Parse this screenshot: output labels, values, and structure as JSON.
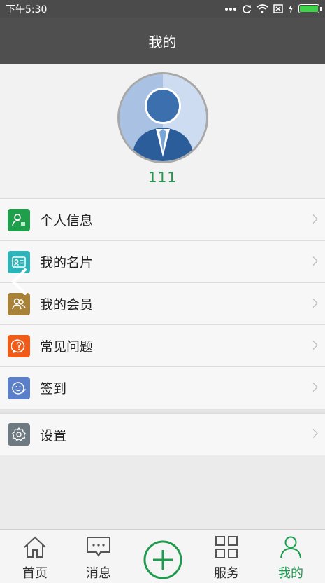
{
  "status_bar": {
    "time": "下午5:30",
    "battery_color": "#3fd24a"
  },
  "header": {
    "title": "我的"
  },
  "profile": {
    "username": "111"
  },
  "menu": {
    "items": [
      {
        "label": "个人信息",
        "icon": "person-info-icon",
        "color": "#1f9e4b"
      },
      {
        "label": "我的名片",
        "icon": "business-card-icon",
        "color": "#2db3b8"
      },
      {
        "label": "我的会员",
        "icon": "members-icon",
        "color": "#a9823a"
      },
      {
        "label": "常见问题",
        "icon": "question-icon",
        "color": "#f25a17"
      },
      {
        "label": "签到",
        "icon": "sign-in-icon",
        "color": "#5b7fc8"
      }
    ],
    "settings": {
      "label": "设置",
      "icon": "gear-icon",
      "color": "#6e7a82"
    }
  },
  "tabs": [
    {
      "label": "首页",
      "icon": "home-icon"
    },
    {
      "label": "消息",
      "icon": "message-icon"
    },
    {
      "label": "",
      "icon": "plus-circle-icon"
    },
    {
      "label": "服务",
      "icon": "grid-icon"
    },
    {
      "label": "我的",
      "icon": "user-icon",
      "active": true
    }
  ],
  "accent_color": "#1f9a4e"
}
